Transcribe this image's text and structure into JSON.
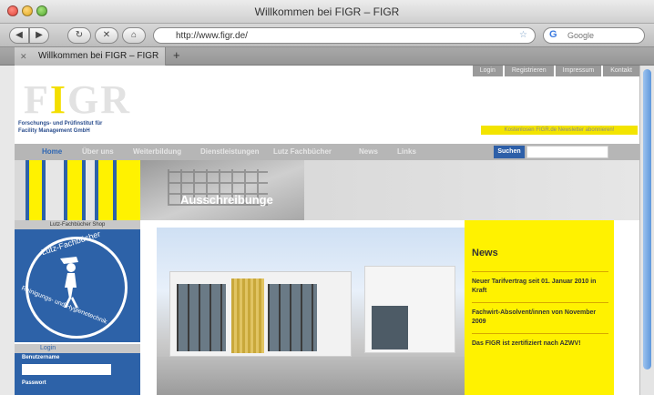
{
  "window": {
    "title": "Willkommen bei FIGR – FIGR"
  },
  "browser": {
    "url": "http://www.figr.de/",
    "search_placeholder": "Google",
    "tab_title": "Willkommen bei FIGR – FIGR",
    "back_icon": "◀",
    "forward_icon": "▶",
    "reload_icon": "↻",
    "stop_icon": "✕",
    "home_icon": "⌂",
    "new_tab_icon": "+",
    "bookmark_icon": "☆"
  },
  "site": {
    "toplinks": [
      "Login",
      "Registrieren",
      "Impressum",
      "Kontakt"
    ],
    "logo": {
      "prefix": "F",
      "accent": "I",
      "suffix": "GR"
    },
    "tagline_line1": "Forschungs- und Prüfinstitut für",
    "tagline_line2": "Facility Management GmbH",
    "newsletter": "Kostenlosen FIGR.de Newsletter abonnieren!",
    "nav": [
      "Home",
      "Über uns",
      "Weiterbildung",
      "Dienstleistungen",
      "Lutz Fachbücher",
      "News",
      "Links"
    ],
    "search_button": "Suchen",
    "hero_title": "Ausschreibunge",
    "shop_label": "Lutz-Fachbücher Shop",
    "book": {
      "top": "Lutz-Fachbücher",
      "bottom": "Reinigungs- und Hygienetechnik"
    },
    "login": {
      "title": "Login",
      "username_label": "Benutzername",
      "password_label": "Passwort"
    },
    "news": {
      "title": "News",
      "items": [
        "Neuer Tarifvertrag seit 01. Januar 2010 in Kraft",
        "Fachwirt-Absolvent/innen von November 2009",
        "Das FIGR ist zertifiziert nach AZWV!"
      ]
    }
  },
  "colors": {
    "brand_blue": "#2d62a8",
    "brand_yellow": "#fff200",
    "nav_gray": "#b6b6b6"
  }
}
